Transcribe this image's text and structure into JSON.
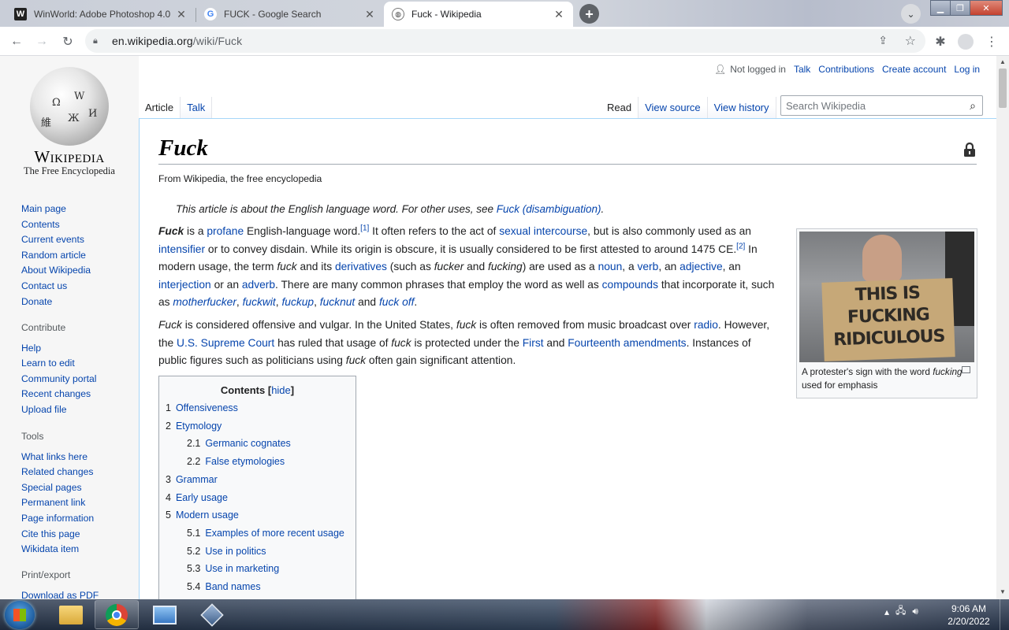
{
  "browser": {
    "tabs": [
      {
        "title": "WinWorld: Adobe Photoshop 4.0",
        "favicon": "W",
        "active": false
      },
      {
        "title": "FUCK - Google Search",
        "favicon": "G",
        "active": false
      },
      {
        "title": "Fuck - Wikipedia",
        "favicon": "globe",
        "active": true
      }
    ],
    "url_host": "en.wikipedia.org",
    "url_path": "/wiki/Fuck"
  },
  "sidebar": {
    "logo_wordmark": "Wikipedia",
    "logo_tagline": "The Free Encyclopedia",
    "nav": [
      "Main page",
      "Contents",
      "Current events",
      "Random article",
      "About Wikipedia",
      "Contact us",
      "Donate"
    ],
    "contribute_heading": "Contribute",
    "contribute": [
      "Help",
      "Learn to edit",
      "Community portal",
      "Recent changes",
      "Upload file"
    ],
    "tools_heading": "Tools",
    "tools": [
      "What links here",
      "Related changes",
      "Special pages",
      "Permanent link",
      "Page information",
      "Cite this page",
      "Wikidata item"
    ],
    "print_heading": "Print/export",
    "print": [
      "Download as PDF"
    ]
  },
  "personal": {
    "not_logged_in": "Not logged in",
    "talk": "Talk",
    "contributions": "Contributions",
    "create_account": "Create account",
    "log_in": "Log in"
  },
  "page_tabs": {
    "article": "Article",
    "talk": "Talk",
    "read": "Read",
    "view_source": "View source",
    "view_history": "View history",
    "search_placeholder": "Search Wikipedia"
  },
  "article": {
    "title": "Fuck",
    "from": "From Wikipedia, the free encyclopedia",
    "hatnote_prefix": "This article is about the English language word. For other uses, see ",
    "hatnote_link": "Fuck (disambiguation)",
    "hatnote_suffix": ".",
    "image_sign_lines": [
      "THIS IS",
      "FUCKING",
      "RIDICULOUS"
    ],
    "caption_pre": "A protester's sign with the word ",
    "caption_em": "fucking",
    "caption_post": " used for emphasis"
  },
  "toc": {
    "title": "Contents",
    "hide": "hide",
    "items": [
      {
        "num": "1",
        "label": "Offensiveness",
        "sub": false
      },
      {
        "num": "2",
        "label": "Etymology",
        "sub": false
      },
      {
        "num": "2.1",
        "label": "Germanic cognates",
        "sub": true
      },
      {
        "num": "2.2",
        "label": "False etymologies",
        "sub": true
      },
      {
        "num": "3",
        "label": "Grammar",
        "sub": false
      },
      {
        "num": "4",
        "label": "Early usage",
        "sub": false
      },
      {
        "num": "5",
        "label": "Modern usage",
        "sub": false
      },
      {
        "num": "5.1",
        "label": "Examples of more recent usage",
        "sub": true
      },
      {
        "num": "5.2",
        "label": "Use in politics",
        "sub": true
      },
      {
        "num": "5.3",
        "label": "Use in marketing",
        "sub": true
      },
      {
        "num": "5.4",
        "label": "Band names",
        "sub": true
      }
    ]
  },
  "taskbar": {
    "time": "9:06 AM",
    "date": "2/20/2022"
  }
}
